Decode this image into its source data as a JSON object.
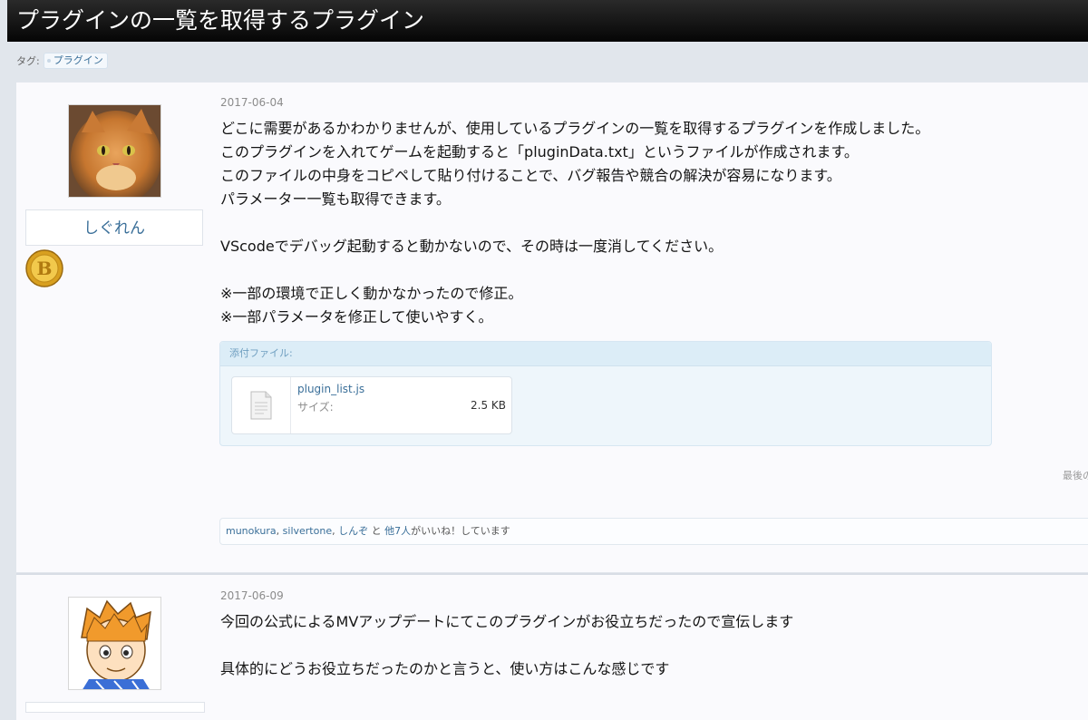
{
  "thread": {
    "title": "プラグインの一覧を取得するプラグイン",
    "tag_label": "タグ:",
    "tags": [
      "プラグイン"
    ]
  },
  "post1": {
    "username": "しぐれん",
    "date": "2017-06-04",
    "lines": [
      "どこに需要があるかわかりませんが、使用しているプラグインの一覧を取得するプラグインを作成しました。",
      "このプラグインを入れてゲームを起動すると「pluginData.txt」というファイルが作成されます。",
      "このファイルの中身をコピペして貼り付けることで、バグ報告や競合の解決が容易になります。",
      "パラメーター一覧も取得できます。",
      "VScodeでデバッグ起動すると動かないので、その時は一度消してください。",
      "※一部の環境で正しく動かなかったので修正。",
      "※一部パラメータを修正して使いやすく。"
    ],
    "attachments": {
      "header": "添付ファイル:",
      "file_name": "plugin_list.js",
      "size_label": "サイズ:",
      "size_value": "2.5 KB"
    },
    "last_edit": "最後の",
    "likes": {
      "user1": "munokura",
      "sep1": ", ",
      "user2": "silvertone",
      "sep2": ", ",
      "user3": "しんぞ",
      "and": " と ",
      "others": "他7人",
      "suffix": "がいいね！しています"
    }
  },
  "post2": {
    "date": "2017-06-09",
    "lines": [
      "今回の公式によるMVアップデートにてこのプラグインがお役立ちだったので宣伝します",
      "具体的にどうお役立ちだったのかと言うと、使い方はこんな感じです"
    ]
  }
}
